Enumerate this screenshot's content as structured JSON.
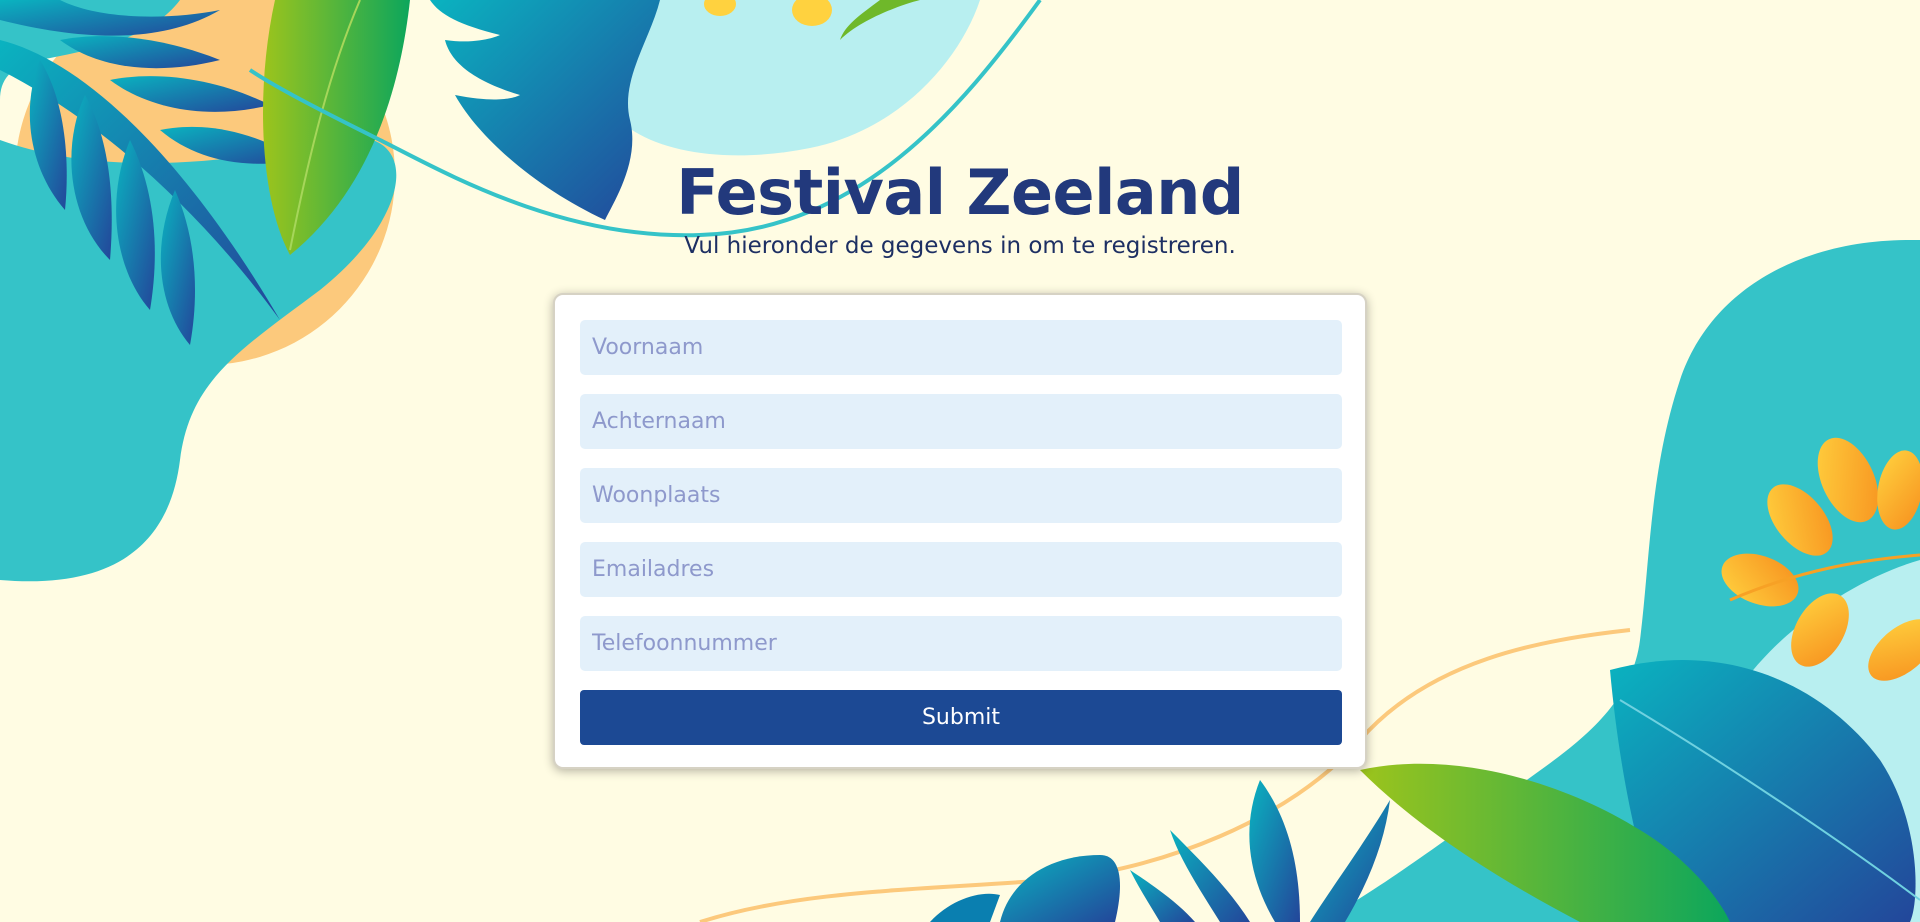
{
  "page": {
    "title": "Festival Zeeland",
    "subtitle": "Vul hieronder de gegevens in om te registreren."
  },
  "form": {
    "fields": [
      {
        "name": "voornaam",
        "placeholder": "Voornaam",
        "value": ""
      },
      {
        "name": "achternaam",
        "placeholder": "Achternaam",
        "value": ""
      },
      {
        "name": "woonplaats",
        "placeholder": "Woonplaats",
        "value": ""
      },
      {
        "name": "emailadres",
        "placeholder": "Emailadres",
        "value": ""
      },
      {
        "name": "telefoonnummer",
        "placeholder": "Telefoonnummer",
        "value": ""
      }
    ],
    "submit_label": "Submit"
  },
  "theme": {
    "background": "#fffce3",
    "title_color": "#22397c",
    "input_background": "#e3f0fa",
    "placeholder_color": "#8e99cc",
    "button_color": "#1c4994",
    "teal": "#35c3c8",
    "light_teal": "#b8eff0",
    "peach": "#fcc97c",
    "leaf_green": "#6fb82a",
    "leaf_blue": "#0a7fb0",
    "orange": "#f7a125"
  }
}
